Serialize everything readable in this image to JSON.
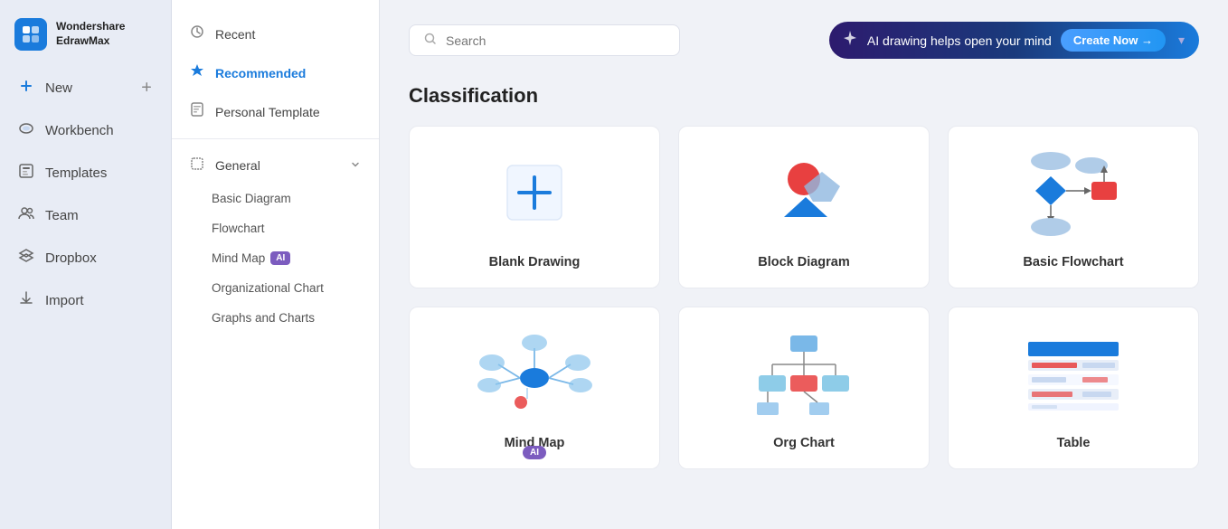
{
  "app": {
    "name_line1": "Wondershare",
    "name_line2": "EdrawMax",
    "logo_letter": "E"
  },
  "sidebar": {
    "items": [
      {
        "id": "new",
        "label": "New",
        "icon": "➕",
        "has_plus": true
      },
      {
        "id": "workbench",
        "label": "Workbench",
        "icon": "☁️"
      },
      {
        "id": "templates",
        "label": "Templates",
        "icon": "🗂️"
      },
      {
        "id": "team",
        "label": "Team",
        "icon": "👥"
      },
      {
        "id": "dropbox",
        "label": "Dropbox",
        "icon": "📦"
      },
      {
        "id": "import",
        "label": "Import",
        "icon": "📥"
      }
    ]
  },
  "middle_panel": {
    "items": [
      {
        "id": "recent",
        "label": "Recent",
        "icon": "🕐",
        "active": false
      },
      {
        "id": "recommended",
        "label": "Recommended",
        "icon": "⭐",
        "active": true
      },
      {
        "id": "personal",
        "label": "Personal Template",
        "icon": "🗒️",
        "active": false
      }
    ],
    "sections": [
      {
        "id": "general",
        "label": "General",
        "icon": "◇",
        "expanded": true,
        "sub_items": [
          {
            "id": "basic-diagram",
            "label": "Basic Diagram",
            "has_ai": false
          },
          {
            "id": "flowchart",
            "label": "Flowchart",
            "has_ai": false
          },
          {
            "id": "mind-map",
            "label": "Mind Map",
            "has_ai": true
          },
          {
            "id": "org-chart",
            "label": "Organizational Chart",
            "has_ai": false
          },
          {
            "id": "graphs",
            "label": "Graphs and Charts",
            "has_ai": false
          }
        ]
      }
    ]
  },
  "topbar": {
    "search_placeholder": "Search",
    "ai_banner_text": "AI drawing helps open your mind",
    "ai_banner_btn": "Create Now →"
  },
  "main": {
    "title": "Classification",
    "cards": [
      {
        "id": "blank",
        "label": "Blank Drawing",
        "type": "blank",
        "has_ai": false
      },
      {
        "id": "block",
        "label": "Block Diagram",
        "type": "block",
        "has_ai": false
      },
      {
        "id": "flowchart",
        "label": "Basic Flowchart",
        "type": "flowchart",
        "has_ai": false
      },
      {
        "id": "mindmap",
        "label": "Mind Map",
        "type": "mindmap",
        "has_ai": true
      },
      {
        "id": "org",
        "label": "Org Chart",
        "type": "org",
        "has_ai": false
      },
      {
        "id": "table",
        "label": "Table",
        "type": "table",
        "has_ai": false
      }
    ]
  }
}
